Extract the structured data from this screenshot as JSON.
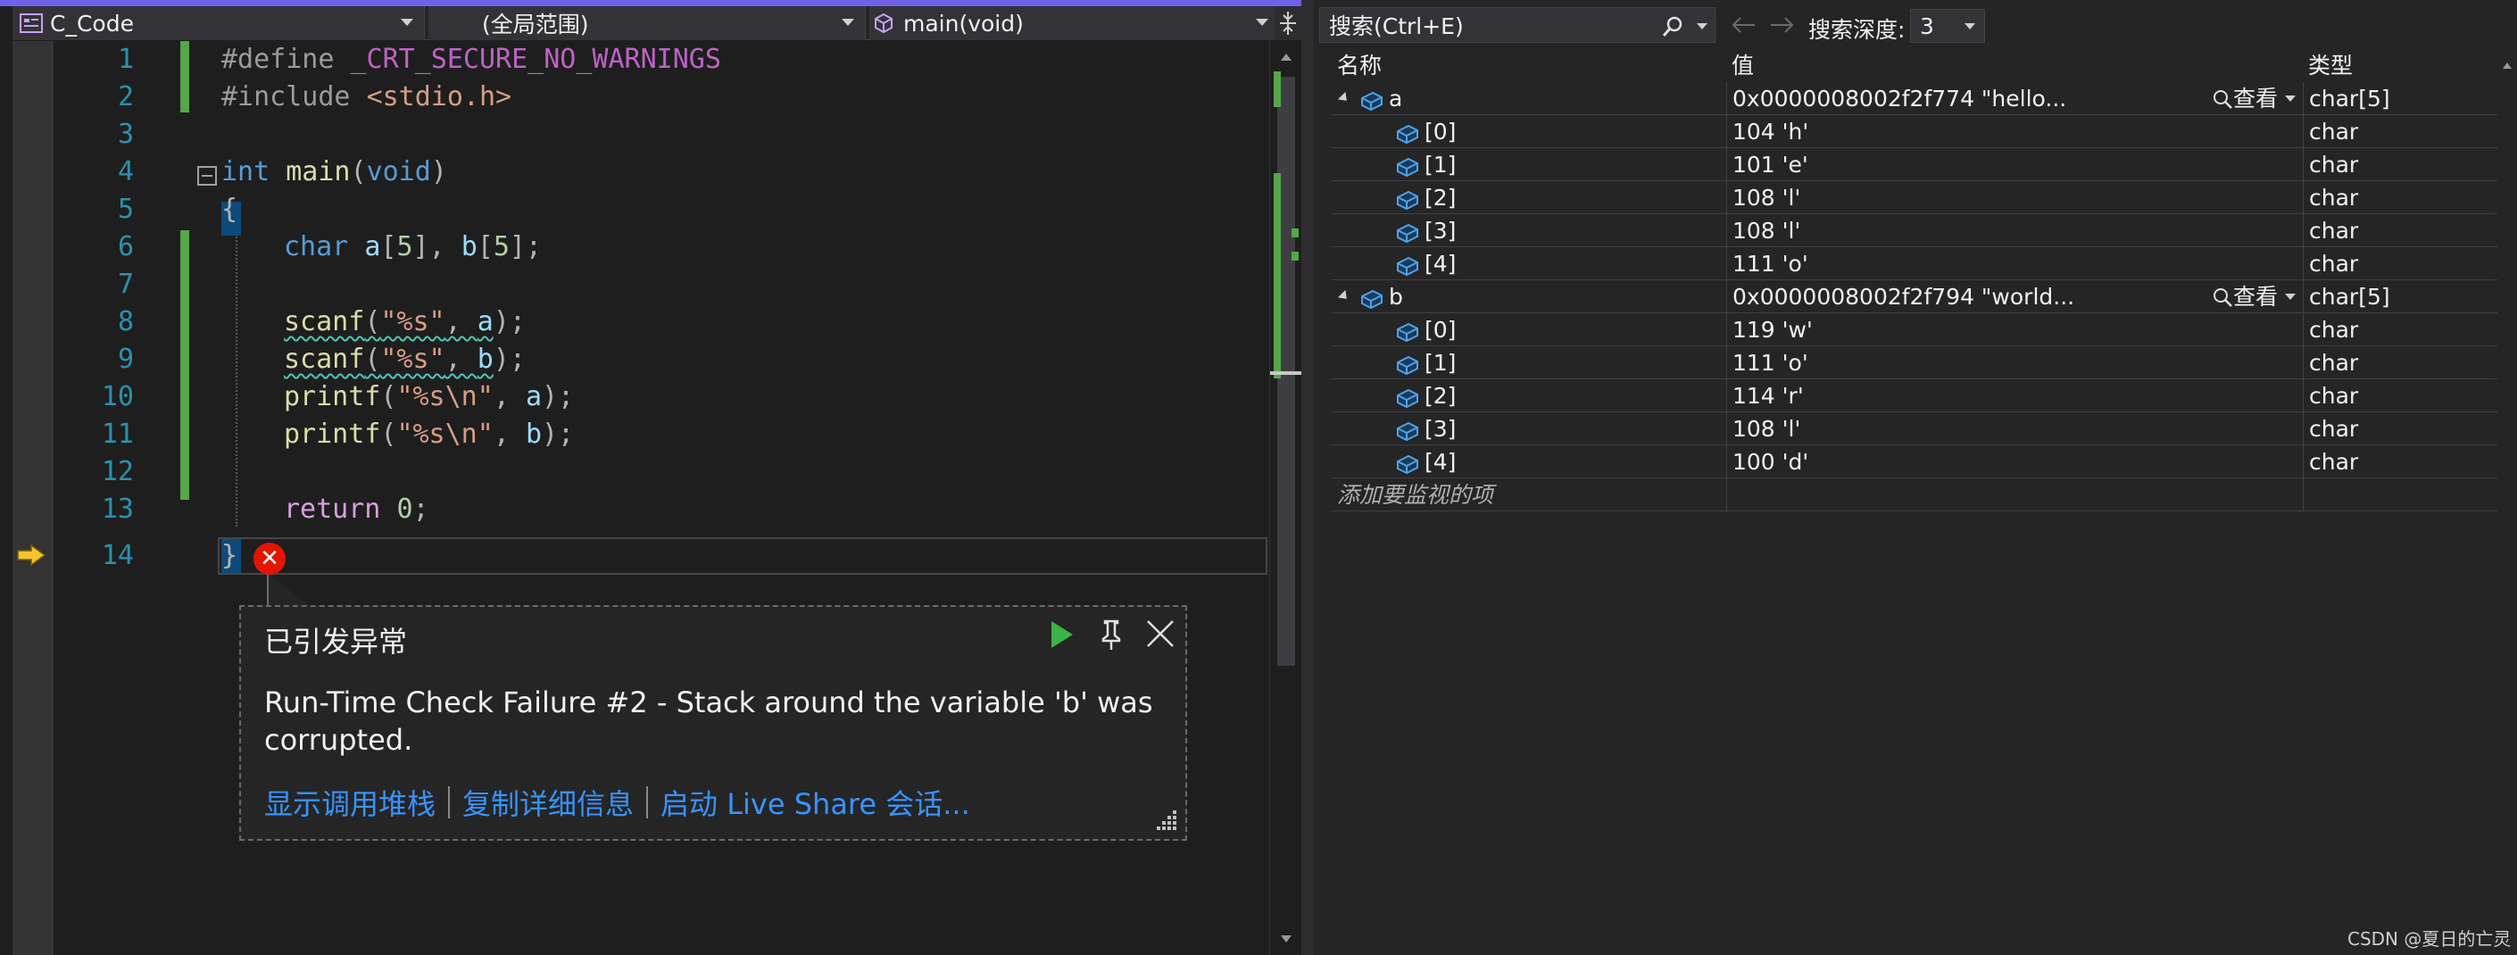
{
  "navbar": {
    "project": "C_Code",
    "scope": "(全局范围)",
    "function": "main(void)"
  },
  "editor": {
    "line_numbers": [
      "1",
      "2",
      "3",
      "4",
      "5",
      "6",
      "7",
      "8",
      "9",
      "10",
      "11",
      "12",
      "13",
      "14"
    ],
    "code": {
      "l1_directive": "#define",
      "l1_macro": "_CRT_SECURE_NO_WARNINGS",
      "l2_directive": "#include",
      "l2_header": "<stdio.h>",
      "l4_type": "int",
      "l4_fn": "main",
      "l4_open": "(",
      "l4_void": "void",
      "l4_close": ")",
      "l5": "{",
      "l6_type": "char",
      "l6_a": "a",
      "l6_mid1": "[",
      "l6_n1": "5",
      "l6_mid2": "], ",
      "l6_b": "b",
      "l6_mid3": "[",
      "l6_n2": "5",
      "l6_end": "];",
      "l8_fn": "scanf",
      "l8_open": "(",
      "l8_str": "\"%s\"",
      "l8_comma": ", ",
      "l8_arg": "a",
      "l8_end": ");",
      "l9_fn": "scanf",
      "l9_open": "(",
      "l9_str": "\"%s\"",
      "l9_comma": ", ",
      "l9_arg": "b",
      "l9_end": ");",
      "l10_fn": "printf",
      "l10_open": "(",
      "l10_str": "\"%s\\n\"",
      "l10_comma": ", ",
      "l10_arg": "a",
      "l10_end": ");",
      "l11_fn": "printf",
      "l11_open": "(",
      "l11_str": "\"%s\\n\"",
      "l11_comma": ", ",
      "l11_arg": "b",
      "l11_end": ");",
      "l13_kw": "return",
      "l13_num": "0",
      "l13_end": ";",
      "l14": "}"
    },
    "error_glyph": "✕"
  },
  "exception": {
    "title": "已引发异常",
    "message": "Run-Time Check Failure #2 - Stack around the variable 'b' was corrupted.",
    "links": [
      "显示调用堆栈",
      "复制详细信息",
      "启动 Live Share 会话..."
    ]
  },
  "watch": {
    "search_placeholder": "搜索(Ctrl+E)",
    "depth_label": "搜索深度:",
    "depth_value": "3",
    "columns": {
      "name": "名称",
      "value": "值",
      "type": "类型"
    },
    "view_label": "查看",
    "rows": [
      {
        "name": "a",
        "value": "0x0000008002f2f774 \"hello...",
        "type": "char[5]",
        "level": 0,
        "expandable": true
      },
      {
        "name": "[0]",
        "value": "104 'h'",
        "type": "char",
        "level": 1
      },
      {
        "name": "[1]",
        "value": "101 'e'",
        "type": "char",
        "level": 1
      },
      {
        "name": "[2]",
        "value": "108 'l'",
        "type": "char",
        "level": 1
      },
      {
        "name": "[3]",
        "value": "108 'l'",
        "type": "char",
        "level": 1
      },
      {
        "name": "[4]",
        "value": "111 'o'",
        "type": "char",
        "level": 1
      },
      {
        "name": "b",
        "value": "0x0000008002f2f794 \"world...",
        "type": "char[5]",
        "level": 0,
        "expandable": true
      },
      {
        "name": "[0]",
        "value": "119 'w'",
        "type": "char",
        "level": 1
      },
      {
        "name": "[1]",
        "value": "111 'o'",
        "type": "char",
        "level": 1
      },
      {
        "name": "[2]",
        "value": "114 'r'",
        "type": "char",
        "level": 1
      },
      {
        "name": "[3]",
        "value": "108 'l'",
        "type": "char",
        "level": 1
      },
      {
        "name": "[4]",
        "value": "100 'd'",
        "type": "char",
        "level": 1
      }
    ],
    "add_item": "添加要监视的项"
  },
  "watermark": "CSDN @夏日的亡灵",
  "colors": {
    "accent": "#7160e8",
    "changed_line": "#57a64a",
    "error": "#e51400",
    "link": "#3794ff",
    "exec_arrow": "#f2c530"
  }
}
